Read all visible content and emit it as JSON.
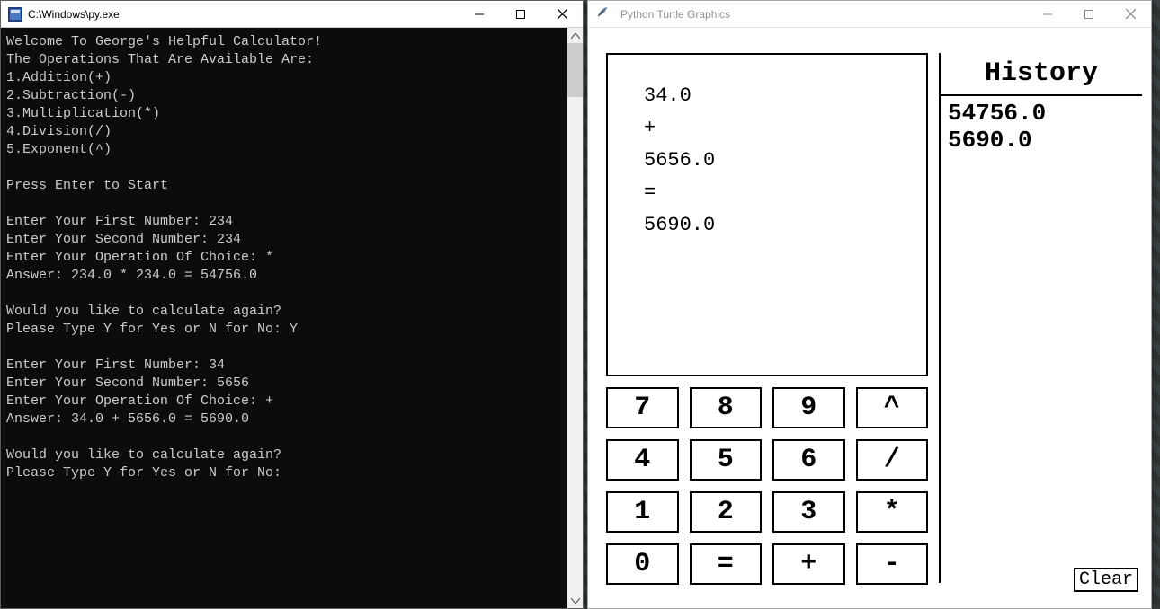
{
  "console": {
    "title": "C:\\Windows\\py.exe",
    "lines": [
      "Welcome To George's Helpful Calculator!",
      "The Operations That Are Available Are:",
      "1.Addition(+)",
      "2.Subtraction(-)",
      "3.Multiplication(*)",
      "4.Division(/)",
      "5.Exponent(^)",
      "",
      "Press Enter to Start",
      "",
      "Enter Your First Number: 234",
      "Enter Your Second Number: 234",
      "Enter Your Operation Of Choice: *",
      "Answer: 234.0 * 234.0 = 54756.0",
      "",
      "Would you like to calculate again?",
      "Please Type Y for Yes or N for No: Y",
      "",
      "Enter Your First Number: 34",
      "Enter Your Second Number: 5656",
      "Enter Your Operation Of Choice: +",
      "Answer: 34.0 + 5656.0 = 5690.0",
      "",
      "Would you like to calculate again?",
      "Please Type Y for Yes or N for No:"
    ]
  },
  "turtle": {
    "title": "Python Turtle Graphics",
    "display": [
      "34.0",
      "+",
      "5656.0",
      "=",
      "5690.0"
    ],
    "buttons": [
      "7",
      "8",
      "9",
      "^",
      "4",
      "5",
      "6",
      "/",
      "1",
      "2",
      "3",
      "*",
      "0",
      "=",
      "+",
      "-"
    ],
    "history_title": "History",
    "history": [
      "54756.0",
      "5690.0"
    ],
    "clear_label": "Clear"
  }
}
